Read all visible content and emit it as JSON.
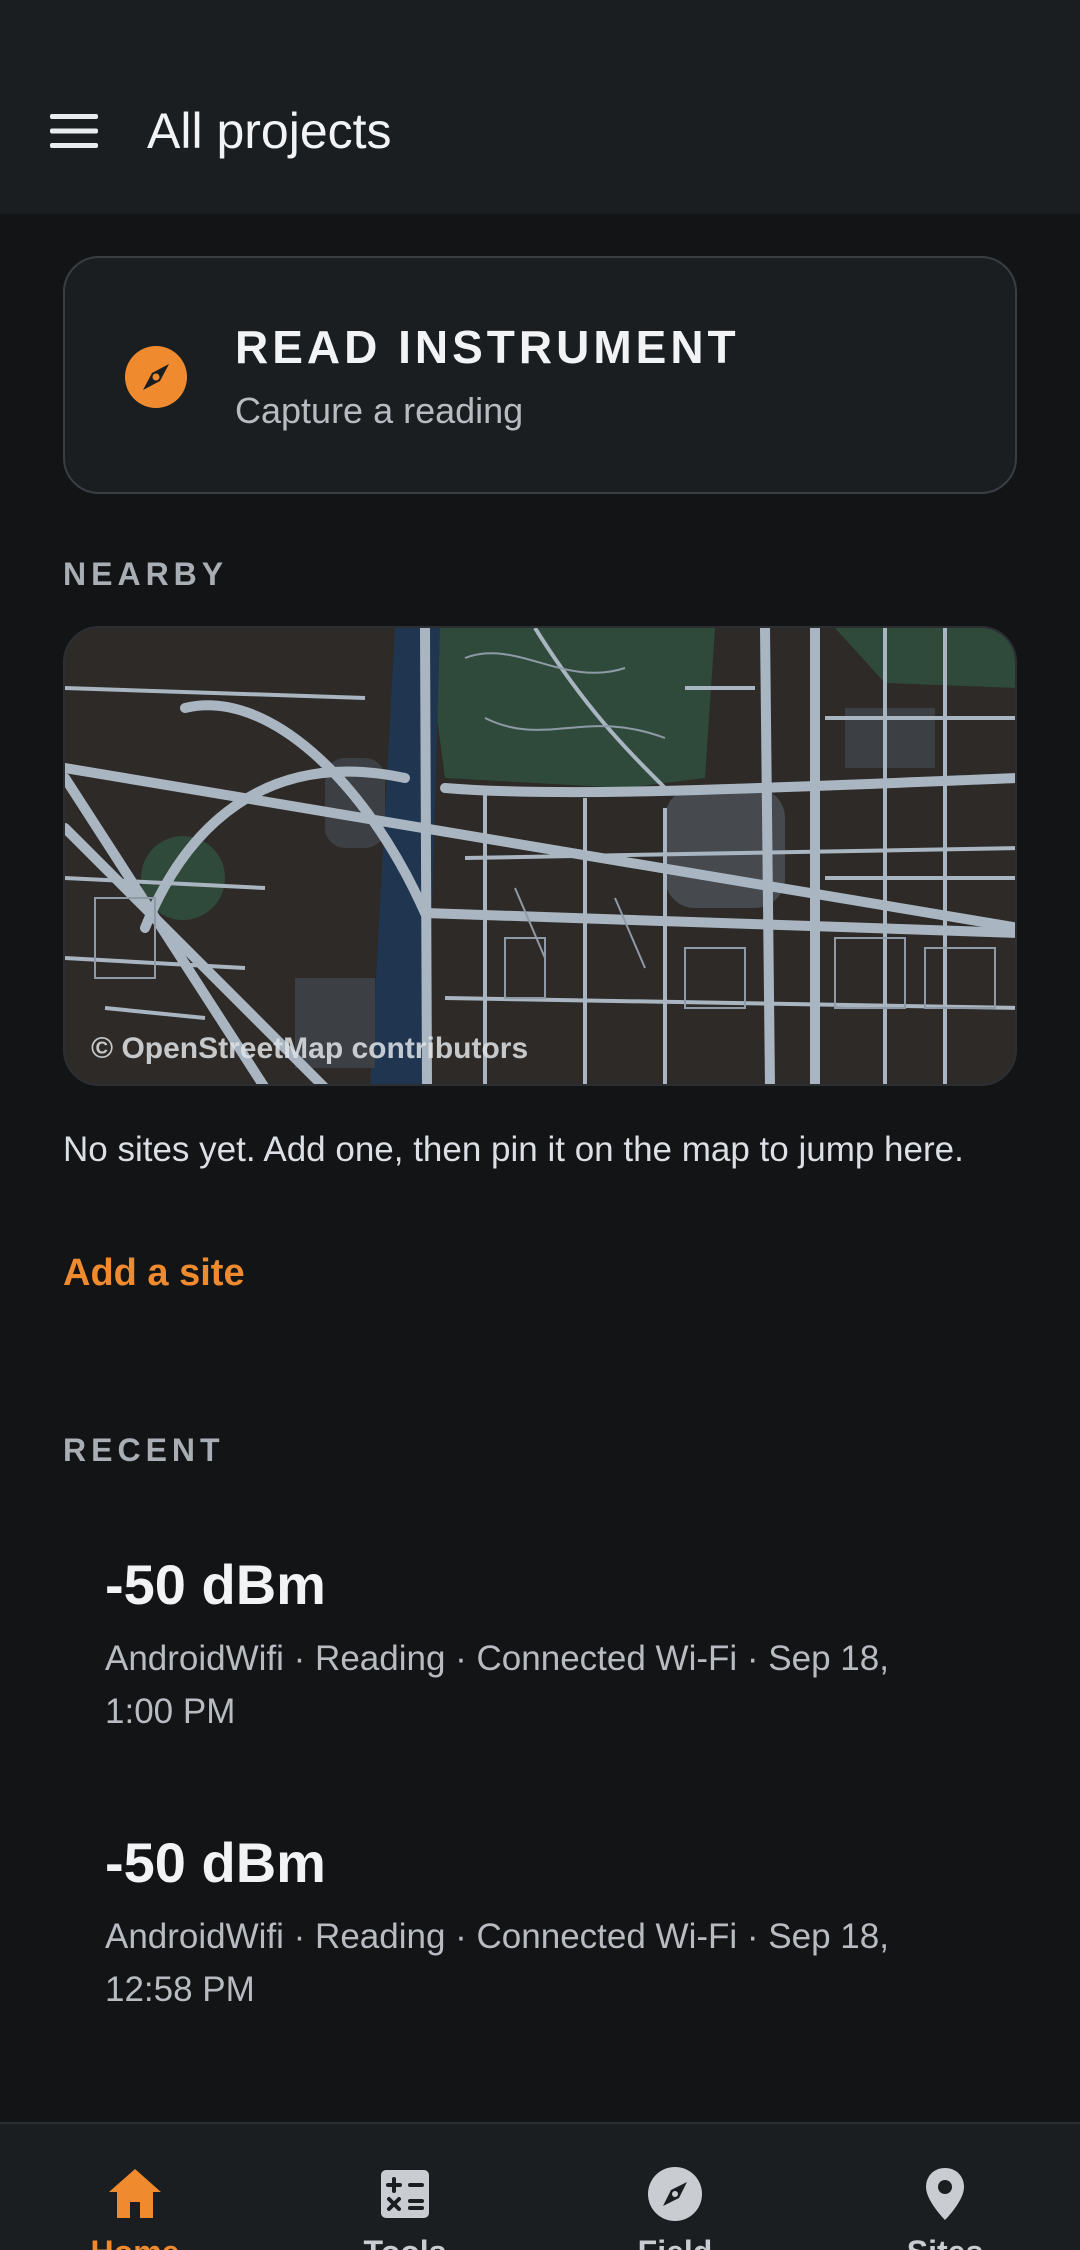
{
  "header": {
    "title": "All projects",
    "menu_icon": "hamburger-menu-icon"
  },
  "read_card": {
    "icon": "compass-icon",
    "title": "READ INSTRUMENT",
    "subtitle": "Capture a reading"
  },
  "nearby": {
    "label": "NEARBY",
    "map_attribution": "© OpenStreetMap contributors",
    "empty_text": "No sites yet. Add one, then pin it on the map to jump here.",
    "add_site_label": "Add a site"
  },
  "recent": {
    "label": "RECENT",
    "items": [
      {
        "value": "-50 dBm",
        "meta": "AndroidWifi · Reading · Connected Wi-Fi · Sep 18, 1:00 PM"
      },
      {
        "value": "-50 dBm",
        "meta": "AndroidWifi · Reading · Connected Wi-Fi · Sep 18, 12:58 PM"
      }
    ]
  },
  "bottom_nav": {
    "items": [
      {
        "label": "Home",
        "icon": "home-icon",
        "active": true
      },
      {
        "label": "Tools",
        "icon": "calculator-icon",
        "active": false
      },
      {
        "label": "Field",
        "icon": "compass-icon",
        "active": false
      },
      {
        "label": "Sites",
        "icon": "location-pin-icon",
        "active": false
      }
    ]
  },
  "colors": {
    "accent": "#f08a2e",
    "background": "#121416",
    "surface": "#1b1e21"
  }
}
